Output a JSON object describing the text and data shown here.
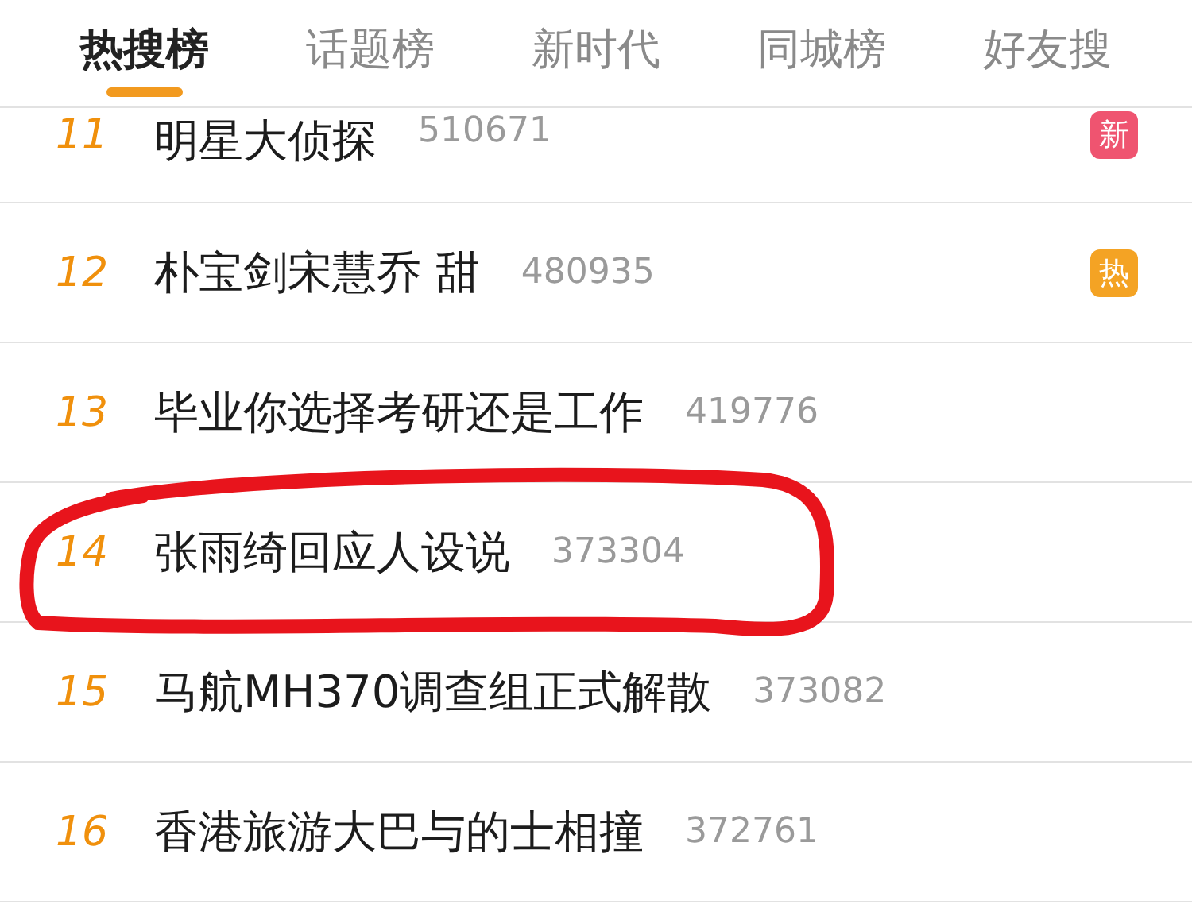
{
  "tabs": [
    {
      "label": "热搜榜",
      "selected": true
    },
    {
      "label": "话题榜",
      "selected": false
    },
    {
      "label": "新时代",
      "selected": false
    },
    {
      "label": "同城榜",
      "selected": false
    },
    {
      "label": "好友搜",
      "selected": false
    }
  ],
  "rows": [
    {
      "rank": "11",
      "title": "明星大侦探",
      "count": "510671",
      "badge": {
        "kind": "new",
        "label": "新"
      },
      "circled": false
    },
    {
      "rank": "12",
      "title": "朴宝剑宋慧乔 甜",
      "count": "480935",
      "badge": {
        "kind": "hot",
        "label": "热"
      },
      "circled": false
    },
    {
      "rank": "13",
      "title": "毕业你选择考研还是工作",
      "count": "419776",
      "circled": false
    },
    {
      "rank": "14",
      "title": "张雨绮回应人设说",
      "count": "373304",
      "circled": true
    },
    {
      "rank": "15",
      "title": "马航MH370调查组正式解散",
      "count": "373082",
      "circled": false
    },
    {
      "rank": "16",
      "title": "香港旅游大巴与的士相撞",
      "count": "372761",
      "circled": false
    }
  ]
}
